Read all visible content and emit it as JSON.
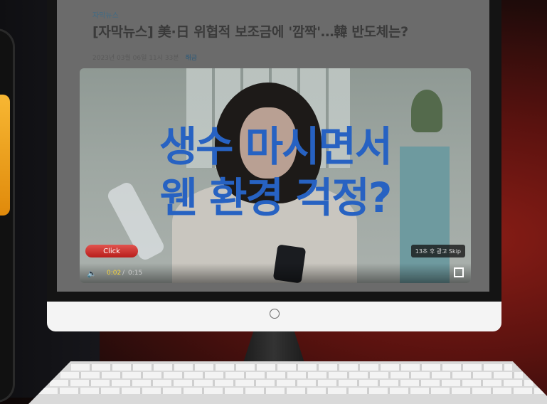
{
  "article": {
    "category": "자막뉴스",
    "title": "[자막뉴스] 美·日 위협적 보조금에 '깜짝'…韓 반도체는?",
    "date": "2023년 03월 06일 11시 33분",
    "category_link": "해금"
  },
  "video_ad": {
    "headline_line1": "생수 마시면서",
    "headline_line2": "웬 환경 걱정?",
    "click_label": "Click",
    "skip_text": "13초 후 광고 Skip",
    "time_current": "0:02",
    "time_separator": "/",
    "time_duration": "0:15",
    "accent_color": "#2762c2",
    "click_color": "#c8302d"
  },
  "icons": {
    "volume": "volume-icon",
    "fullscreen": "fullscreen-icon",
    "power": "power-button-icon"
  }
}
